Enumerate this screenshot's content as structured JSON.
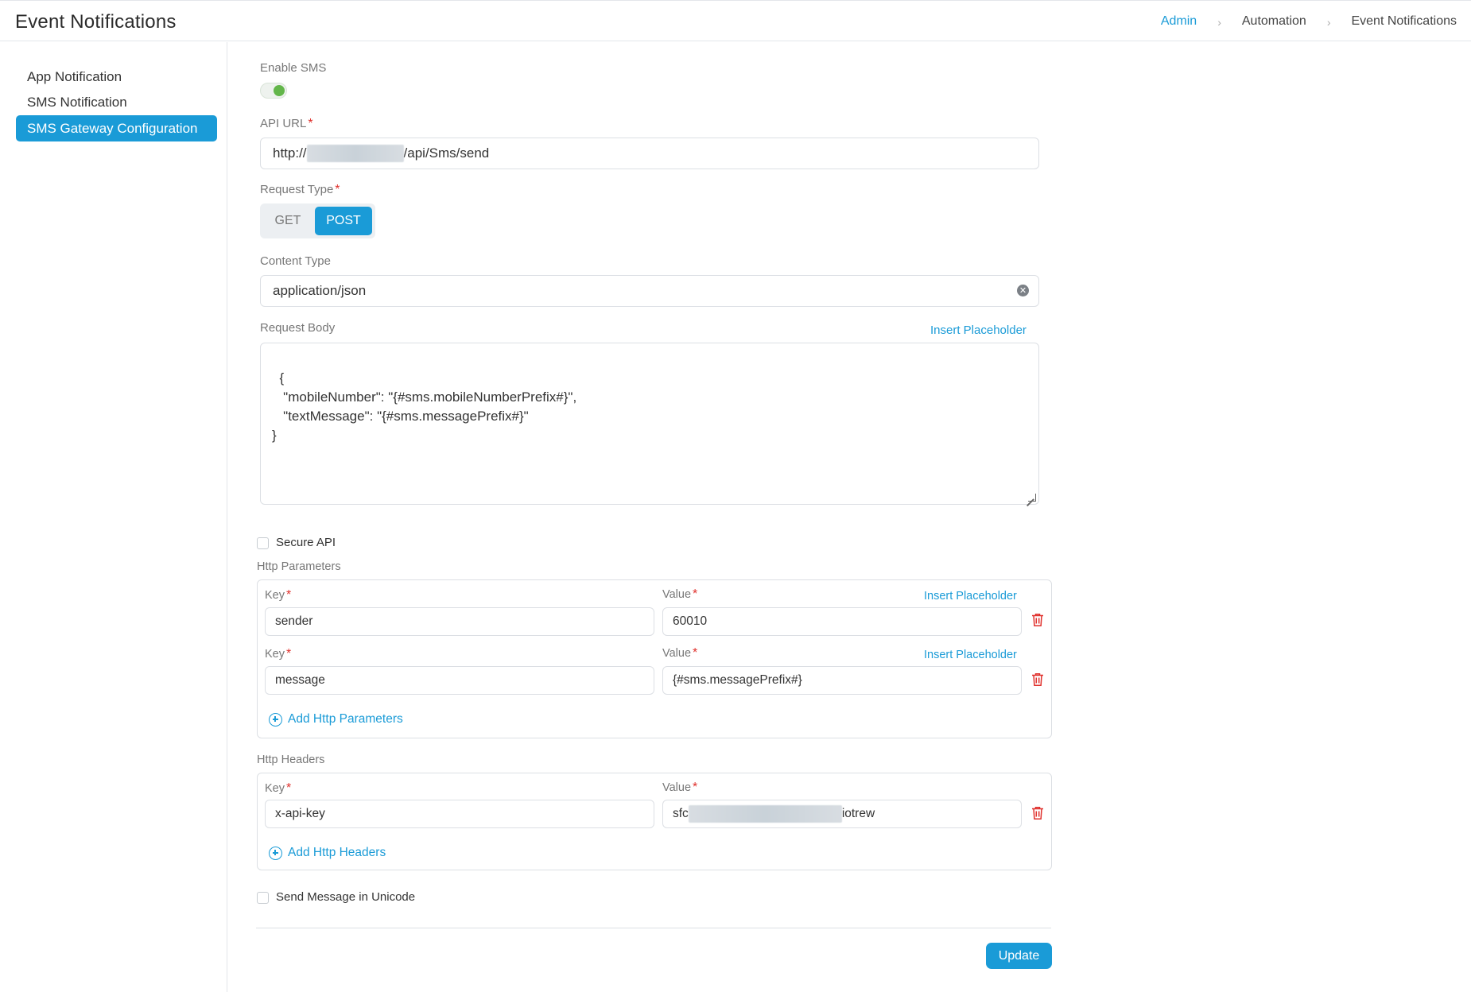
{
  "header": {
    "title": "Event Notifications",
    "breadcrumb": [
      "Admin",
      "Automation",
      "Event Notifications"
    ]
  },
  "sidebar": {
    "items": [
      {
        "label": "App Notification",
        "active": false
      },
      {
        "label": "SMS Notification",
        "active": false
      },
      {
        "label": "SMS Gateway Configuration",
        "active": true
      }
    ]
  },
  "form": {
    "enable_sms": {
      "label": "Enable SMS",
      "enabled": true
    },
    "api_url": {
      "label": "API URL",
      "prefix": "http://",
      "suffix": "/api/Sms/send"
    },
    "request_type": {
      "label": "Request Type",
      "options": [
        "GET",
        "POST"
      ],
      "selected": "POST"
    },
    "content_type": {
      "label": "Content Type",
      "value": "application/json"
    },
    "request_body": {
      "label": "Request Body",
      "insert_placeholder": "Insert Placeholder",
      "value": "{\n   \"mobileNumber\": \"{#sms.mobileNumberPrefix#}\",\n   \"textMessage\": \"{#sms.messagePrefix#}\"\n}"
    },
    "secure_api": {
      "label": "Secure API",
      "checked": false
    },
    "http_parameters": {
      "title": "Http Parameters",
      "key_label": "Key",
      "value_label": "Value",
      "insert_placeholder": "Insert Placeholder",
      "rows": [
        {
          "key": "sender",
          "value": "60010"
        },
        {
          "key": "message",
          "value": "{#sms.messagePrefix#}"
        }
      ],
      "add_label": "Add Http Parameters"
    },
    "http_headers": {
      "title": "Http Headers",
      "key_label": "Key",
      "value_label": "Value",
      "rows": [
        {
          "key": "x-api-key",
          "value_prefix": "sfc",
          "value_suffix": "iotrew"
        }
      ],
      "add_label": "Add Http Headers"
    },
    "unicode": {
      "label": "Send Message in Unicode",
      "checked": false
    },
    "update_label": "Update"
  },
  "colors": {
    "accent": "#1a9bd7",
    "toggle_on": "#63b64a",
    "required": "#e0302c",
    "delete": "#e0302c"
  }
}
